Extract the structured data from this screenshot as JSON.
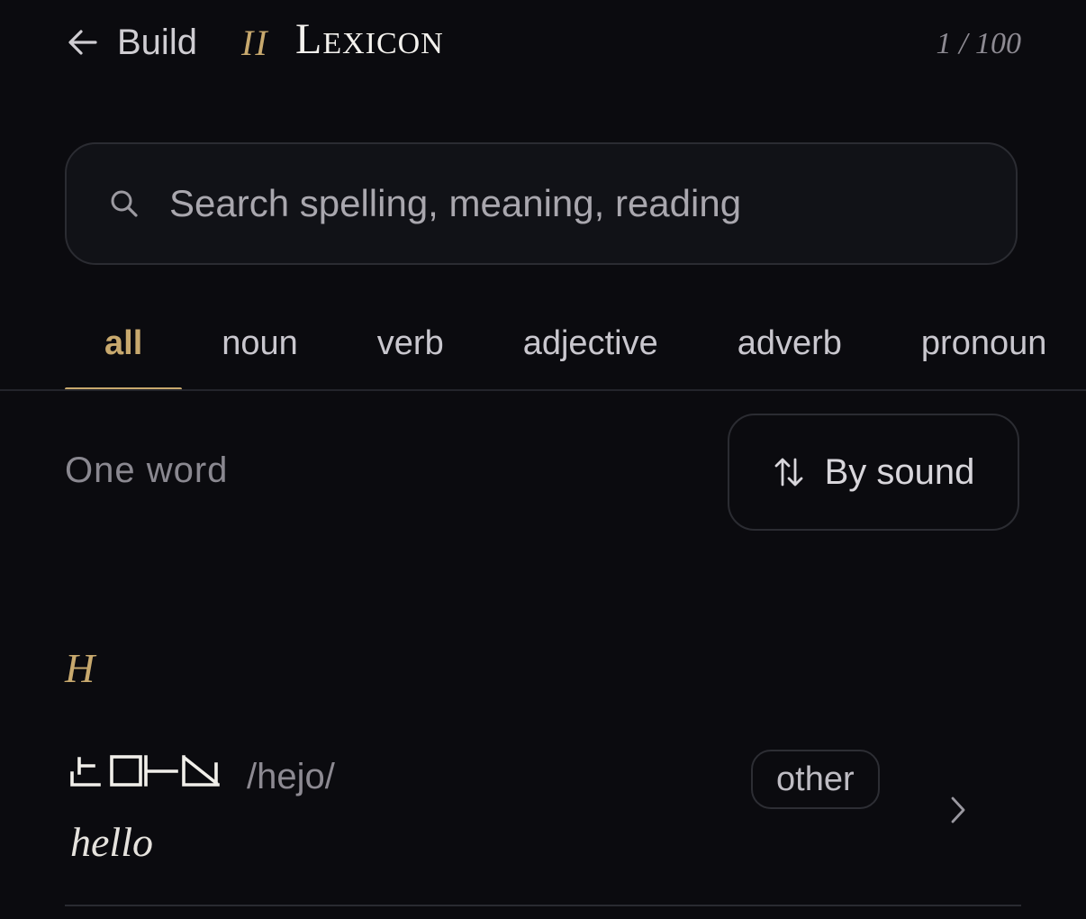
{
  "header": {
    "back_label": "Build",
    "section_numeral": "II",
    "title": "Lexicon",
    "counter": "1 / 100"
  },
  "search": {
    "placeholder": "Search spelling, meaning, reading",
    "value": ""
  },
  "tabs": [
    {
      "label": "all",
      "active": true
    },
    {
      "label": "noun"
    },
    {
      "label": "verb"
    },
    {
      "label": "adjective"
    },
    {
      "label": "adverb"
    },
    {
      "label": "pronoun"
    }
  ],
  "list": {
    "count_label": "One word",
    "sort_label": "By sound",
    "sections": [
      {
        "letter": "H",
        "entries": [
          {
            "reading": "/hejo/",
            "meaning": "hello",
            "part_of_speech": "other",
            "script_icon": "conscript-glyphs"
          }
        ]
      }
    ]
  },
  "colors": {
    "background": "#0b0b0f",
    "accent": "#c8a96e",
    "text": "#e9e7e3",
    "muted": "#8d8a92",
    "border": "#2b2c32"
  },
  "icons": {
    "back": "arrow-left-icon",
    "search": "search-icon",
    "sort": "sort-arrows-icon",
    "chevron": "chevron-right-icon"
  }
}
